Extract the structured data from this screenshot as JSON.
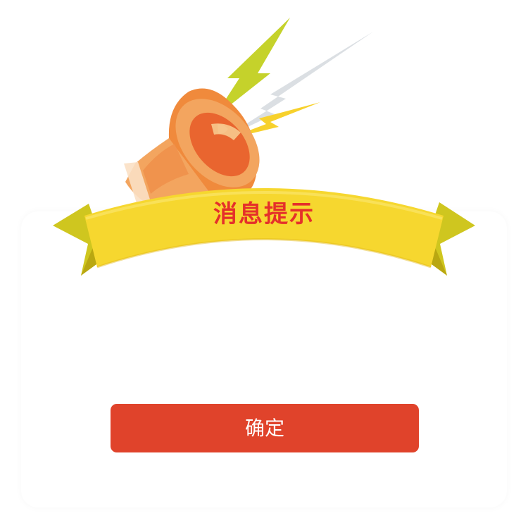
{
  "dialog": {
    "title": "消息提示",
    "message": "",
    "confirm_label": "确定"
  },
  "icons": {
    "header": "megaphone-icon",
    "banner": "ribbon-banner"
  },
  "colors": {
    "button": "#e0432b",
    "title": "#e5302a",
    "ribbon": "#f6d72f",
    "megaphone": "#f08a3c",
    "bolt_green": "#c5d22b",
    "bolt_yellow": "#f7d12c",
    "bolt_grey": "#d9dde2"
  }
}
